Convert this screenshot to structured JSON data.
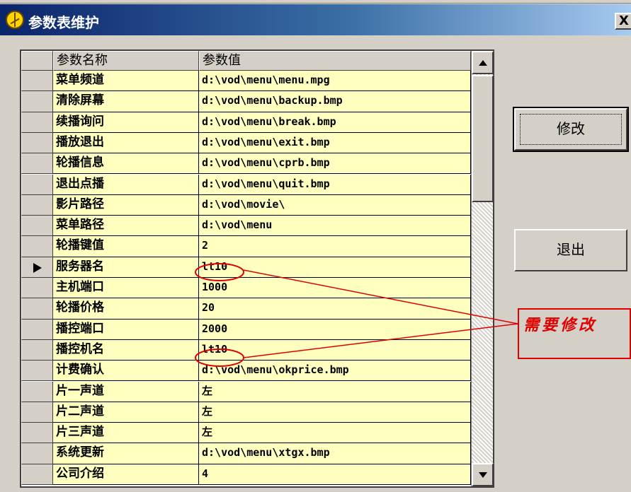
{
  "window": {
    "title": "参数表维护",
    "close_label": "X"
  },
  "grid": {
    "columns": [
      "参数名称",
      "参数值"
    ],
    "current_row_index": 9,
    "rows": [
      {
        "name": "菜单频道",
        "value": "d:\\vod\\menu\\menu.mpg"
      },
      {
        "name": "清除屏幕",
        "value": "d:\\vod\\menu\\backup.bmp"
      },
      {
        "name": "续播询问",
        "value": "d:\\vod\\menu\\break.bmp"
      },
      {
        "name": "播放退出",
        "value": "d:\\vod\\menu\\exit.bmp"
      },
      {
        "name": "轮播信息",
        "value": "d:\\vod\\menu\\cprb.bmp"
      },
      {
        "name": "退出点播",
        "value": "d:\\vod\\menu\\quit.bmp"
      },
      {
        "name": "影片路径",
        "value": "d:\\vod\\movie\\"
      },
      {
        "name": "菜单路径",
        "value": "d:\\vod\\menu"
      },
      {
        "name": "轮播键值",
        "value": "2"
      },
      {
        "name": "服务器名",
        "value": "lt10"
      },
      {
        "name": "主机端口",
        "value": "1000"
      },
      {
        "name": "轮播价格",
        "value": "20"
      },
      {
        "name": "播控端口",
        "value": "2000"
      },
      {
        "name": "播控机名",
        "value": "lt10"
      },
      {
        "name": "计费确认",
        "value": "d:\\vod\\menu\\okprice.bmp"
      },
      {
        "name": "片一声道",
        "value": "左"
      },
      {
        "name": "片二声道",
        "value": "左"
      },
      {
        "name": "片三声道",
        "value": "左"
      },
      {
        "name": "系统更新",
        "value": "d:\\vod\\menu\\xtgx.bmp"
      },
      {
        "name": "公司介绍",
        "value": "4"
      }
    ]
  },
  "buttons": {
    "modify": "修改",
    "exit": "退出"
  },
  "annotation": {
    "text": "需要修改",
    "color": "#e00000"
  },
  "icons": {
    "title": "peace-sign-icon",
    "scroll_up": "arrow-up-icon",
    "scroll_down": "arrow-down-icon",
    "row_pointer": "row-pointer-icon"
  },
  "colors": {
    "cell_bg": "#ffffc0",
    "face": "#d4d0c8",
    "title_start": "#0a246a"
  }
}
